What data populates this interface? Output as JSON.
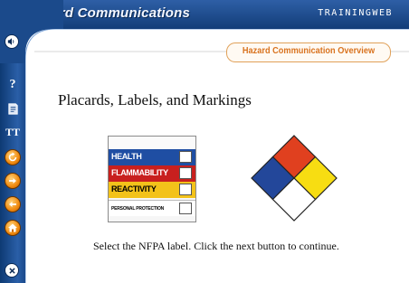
{
  "header": {
    "title": "Hazard Communications",
    "brand": "TRAININGWEB"
  },
  "sidebar": {
    "buttons": [
      {
        "icon": "speaker-icon",
        "label": "Audio"
      },
      {
        "icon": "help-icon",
        "label": "?"
      },
      {
        "icon": "notes-icon",
        "label": "Notes"
      },
      {
        "icon": "font-size-icon",
        "label": "TT"
      },
      {
        "icon": "replay-icon",
        "label": "Replay"
      },
      {
        "icon": "next-icon",
        "label": "Next"
      },
      {
        "icon": "back-icon",
        "label": "Back"
      },
      {
        "icon": "home-icon",
        "label": "Home"
      },
      {
        "icon": "close-icon",
        "label": "Exit"
      }
    ]
  },
  "main": {
    "section": "Hazard Communication Overview",
    "heading": "Placards, Labels, and Markings",
    "instruction": "Select the NFPA label.  Click the next button to continue.",
    "label": {
      "rows": [
        {
          "text": "HEALTH",
          "color": "#1f4ea3",
          "text_color": "#ffffff"
        },
        {
          "text": "FLAMMABILITY",
          "color": "#c8201e",
          "text_color": "#ffffff"
        },
        {
          "text": "REACTIVITY",
          "color": "#f3c21a",
          "text_color": "#000000"
        },
        {
          "text": "PERSONAL PROTECTION",
          "color": "#ffffff",
          "text_color": "#000000"
        }
      ]
    },
    "diamond": {
      "colors": {
        "top": "#e0401f",
        "left": "#23479a",
        "right": "#f7dd12",
        "bottom": "#ffffff"
      }
    }
  },
  "colors": {
    "header_blue": "#1e4d8f",
    "accent_orange": "#f08a10"
  }
}
